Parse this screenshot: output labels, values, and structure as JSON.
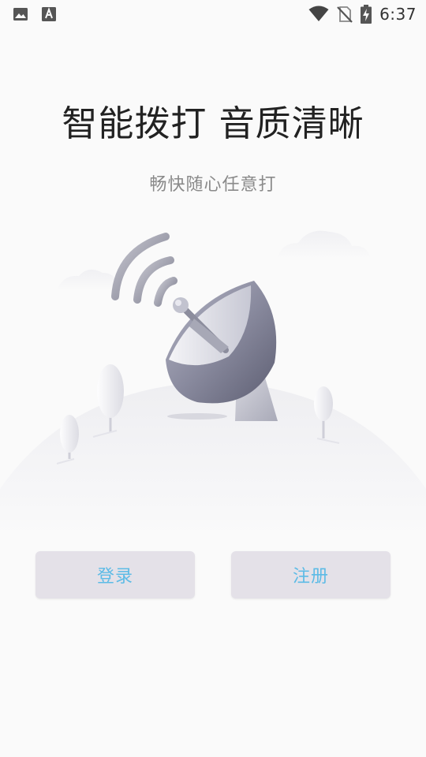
{
  "status_bar": {
    "time": "6:37",
    "left_icons": [
      "image-icon",
      "text-a-icon"
    ],
    "right_icons": [
      "wifi-icon",
      "no-sim-icon",
      "battery-charging-icon"
    ]
  },
  "headline": "智能拨打 音质清晰",
  "subtitle": "畅快随心任意打",
  "illustration": {
    "subject": "satellite-dish-icon"
  },
  "buttons": {
    "login": "登录",
    "register": "注册"
  },
  "colors": {
    "background": "#fafafa",
    "button_bg": "#e4e1e8",
    "button_text": "#5dbbe6",
    "headline": "#222222",
    "subtitle": "#8a8a8a"
  }
}
